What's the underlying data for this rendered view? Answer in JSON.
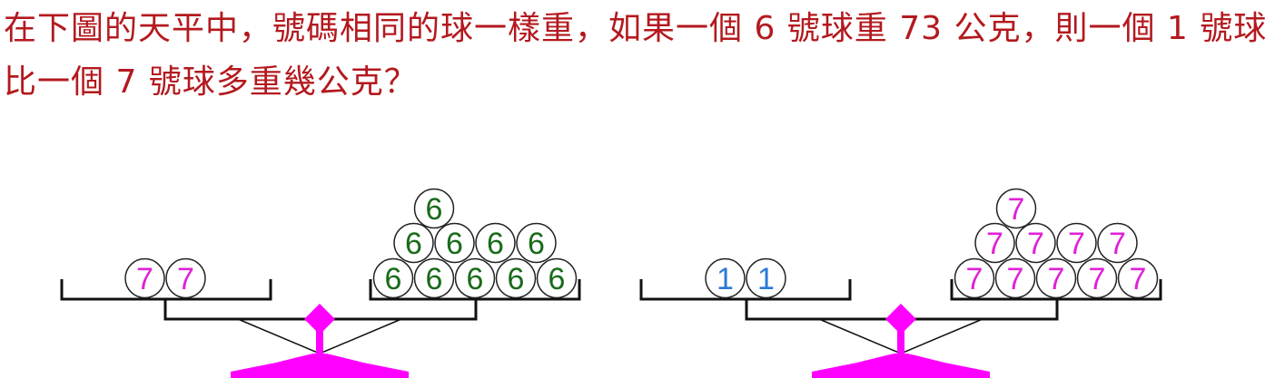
{
  "question": "在下圖的天平中，號碼相同的球一樣重，如果一個 6 號球重 73 公克，則一個 1 號球比一個 7 號球多重幾公克？",
  "colors": {
    "question_text": "#b3191e",
    "ball_6": "#1a6b1a",
    "ball_7": "#e020d8",
    "ball_1": "#2a7ad6",
    "base": "#ff00ff",
    "line": "#111111"
  },
  "balance_left": {
    "left_pan": [
      "7",
      "7"
    ],
    "right_pan_top": [
      "6"
    ],
    "right_pan_middle": [
      "6",
      "6",
      "6",
      "6"
    ],
    "right_pan_bottom": [
      "6",
      "6",
      "6",
      "6",
      "6"
    ]
  },
  "balance_right": {
    "left_pan": [
      "1",
      "1"
    ],
    "right_pan_top": [
      "7"
    ],
    "right_pan_middle": [
      "7",
      "7",
      "7",
      "7"
    ],
    "right_pan_bottom": [
      "7",
      "7",
      "7",
      "7",
      "7"
    ]
  }
}
